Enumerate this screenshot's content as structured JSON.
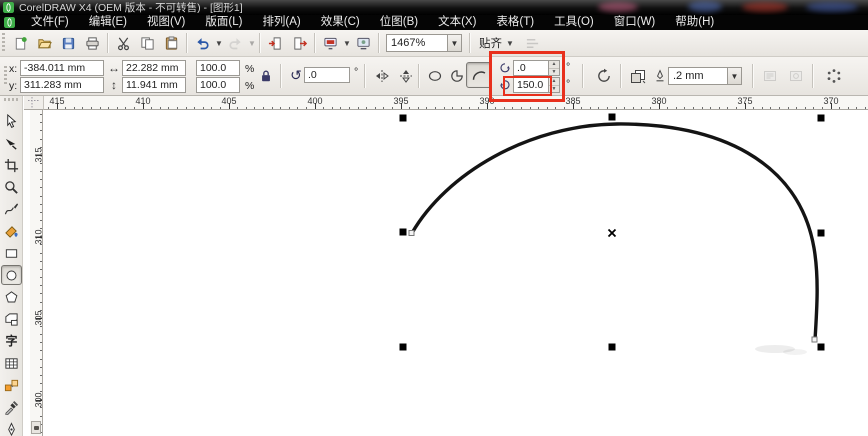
{
  "window": {
    "title": "CorelDRAW X4 (OEM 版本 - 不可转售) - [图形1]"
  },
  "menubar": {
    "items": [
      {
        "name": "menu-item-file",
        "label": "文件(F)"
      },
      {
        "name": "menu-item-edit",
        "label": "编辑(E)"
      },
      {
        "name": "menu-item-view",
        "label": "视图(V)"
      },
      {
        "name": "menu-item-layout",
        "label": "版面(L)"
      },
      {
        "name": "menu-item-arrange",
        "label": "排列(A)"
      },
      {
        "name": "menu-item-effects",
        "label": "效果(C)"
      },
      {
        "name": "menu-item-bitmaps",
        "label": "位图(B)"
      },
      {
        "name": "menu-item-text",
        "label": "文本(X)"
      },
      {
        "name": "menu-item-table",
        "label": "表格(T)"
      },
      {
        "name": "menu-item-tools",
        "label": "工具(O)"
      },
      {
        "name": "menu-item-window",
        "label": "窗口(W)"
      },
      {
        "name": "menu-item-help",
        "label": "帮助(H)"
      }
    ]
  },
  "toolbar": {
    "zoom_level": "1467%",
    "snap_label": "贴齐",
    "buttons": [
      {
        "name": "new-document-button",
        "icon": "new-doc"
      },
      {
        "name": "open-button",
        "icon": "open"
      },
      {
        "name": "save-button",
        "icon": "save"
      },
      {
        "name": "print-button",
        "icon": "print"
      },
      {
        "sep": true
      },
      {
        "name": "cut-button",
        "icon": "cut"
      },
      {
        "name": "copy-button",
        "icon": "copy"
      },
      {
        "name": "paste-button",
        "icon": "paste"
      },
      {
        "sep": true
      },
      {
        "name": "undo-button",
        "icon": "undo",
        "dropdown": true
      },
      {
        "name": "redo-button",
        "icon": "redo",
        "dropdown": true,
        "disabled": true
      },
      {
        "sep": true
      },
      {
        "name": "import-button",
        "icon": "import"
      },
      {
        "name": "export-button",
        "icon": "export"
      },
      {
        "sep": true
      },
      {
        "name": "application-launcher-button",
        "icon": "app-launch",
        "dropdown": true
      },
      {
        "name": "welcome-screen-button",
        "icon": "welcome"
      },
      {
        "sep": true
      }
    ]
  },
  "property_bar": {
    "x_label": "x:",
    "x_value": "-384.011 mm",
    "y_label": "y:",
    "y_value": "311.283 mm",
    "width_value": "22.282 mm",
    "height_value": "11.941 mm",
    "scale_h_value": "100.0",
    "scale_v_value": "100.0",
    "percent_sign": "%",
    "rotation_value": ".0",
    "degree_sign": "°",
    "arc_start_value": ".0",
    "arc_end_value": "150.0",
    "outline_width_value": ".2 mm"
  },
  "rulers": {
    "horizontal_labels": [
      "415",
      "410",
      "405",
      "400",
      "395",
      "390",
      "385",
      "380",
      "375",
      "370"
    ],
    "vertical_labels": [
      "315",
      "310",
      "305",
      "300"
    ]
  },
  "toolbox": {
    "tools": [
      {
        "name": "pick-tool",
        "icon": "pick"
      },
      {
        "name": "shape-tool",
        "icon": "shape"
      },
      {
        "name": "crop-tool",
        "icon": "crop"
      },
      {
        "name": "zoom-tool",
        "icon": "zoomt"
      },
      {
        "name": "freehand-tool",
        "icon": "freehand"
      },
      {
        "name": "smart-fill-tool",
        "icon": "smartfill"
      },
      {
        "name": "rectangle-tool",
        "icon": "recttool"
      },
      {
        "name": "ellipse-tool",
        "icon": "ellipsetool",
        "selected": true
      },
      {
        "name": "polygon-tool",
        "icon": "polygon"
      },
      {
        "name": "basic-shapes-tool",
        "icon": "basicshapes"
      },
      {
        "name": "text-tool",
        "icon": "texttool"
      },
      {
        "name": "table-tool",
        "icon": "tabletool"
      },
      {
        "name": "blend-tool",
        "icon": "blend"
      },
      {
        "name": "eyedropper-tool",
        "icon": "eyedropper"
      },
      {
        "name": "outline-pen-tool",
        "icon": "outlinepen"
      }
    ]
  },
  "annotations": {
    "highlight_color": "#e8301d"
  }
}
